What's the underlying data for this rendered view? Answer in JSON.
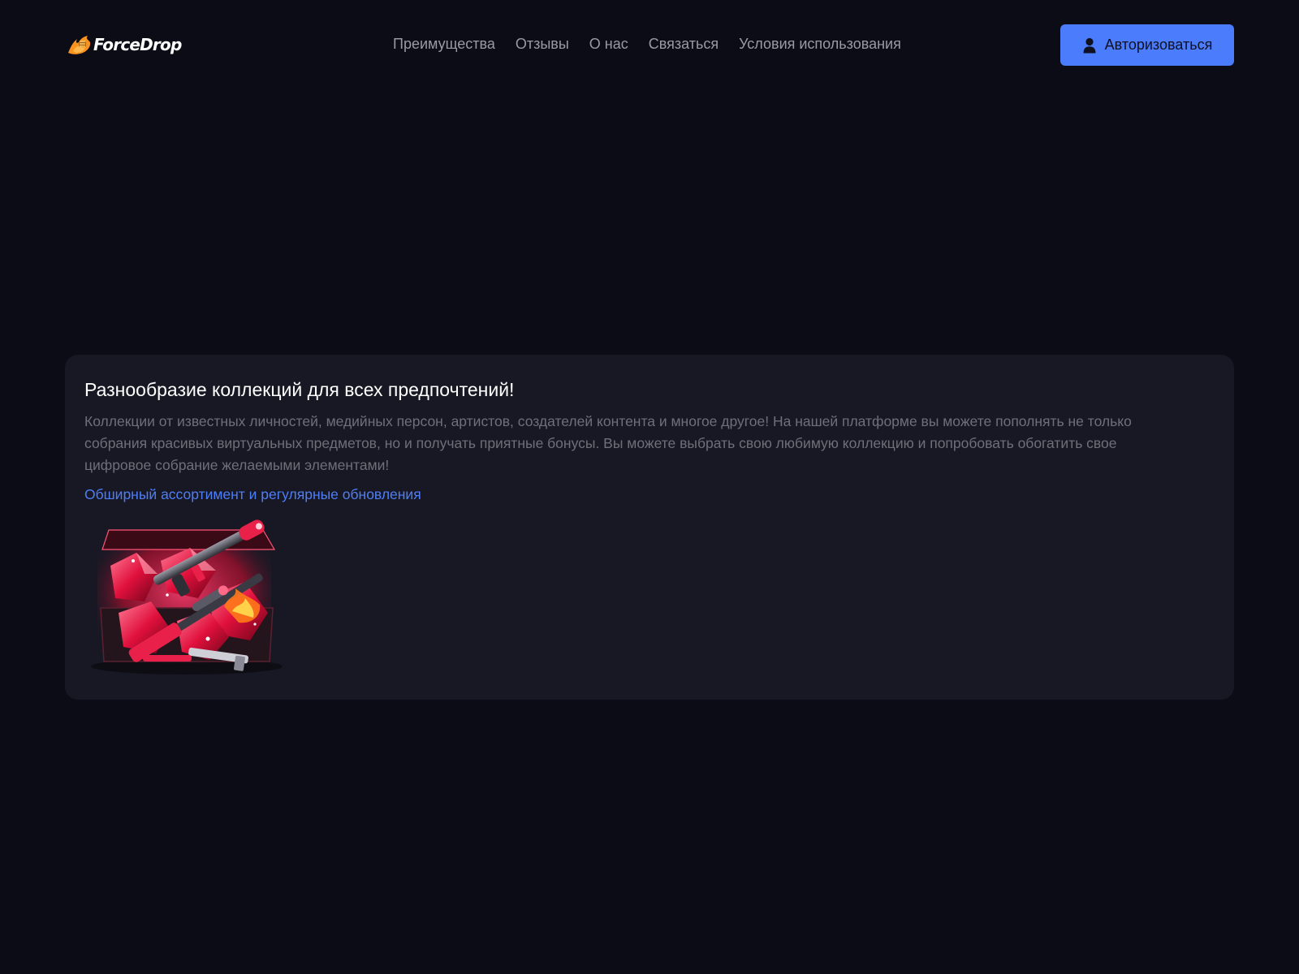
{
  "header": {
    "logo_text": "ForceDrop",
    "nav": [
      "Преимущества",
      "Отзывы",
      "О нас",
      "Связаться",
      "Условия использования"
    ],
    "login_label": "Авторизоваться"
  },
  "card": {
    "title": "Разнообразие коллекций для всех предпочтений!",
    "description": "Коллекции от известных личностей, медийных персон, артистов, создателей контента и многое другое! На нашей платформе вы можете пополнять не только собрания красивых виртуальных предметов, но и получать приятные бонусы. Вы можете выбрать свою любимую коллекцию и попробовать обогатить свое цифровое собрание желаемыми элементами!",
    "link": "Обширный ассортимент и регулярные обновления"
  },
  "icons": {
    "logo": "flame-fist-icon",
    "login": "user-icon",
    "case": "ruby-weapon-case-image"
  },
  "colors": {
    "background": "#0c0c17",
    "card": "#181824",
    "accent": "#4a7cfb",
    "link": "#4d7ef6",
    "nav_text": "#9a9aa5",
    "body_text": "#6f6f7a",
    "logo_orange": "#f7931e"
  }
}
